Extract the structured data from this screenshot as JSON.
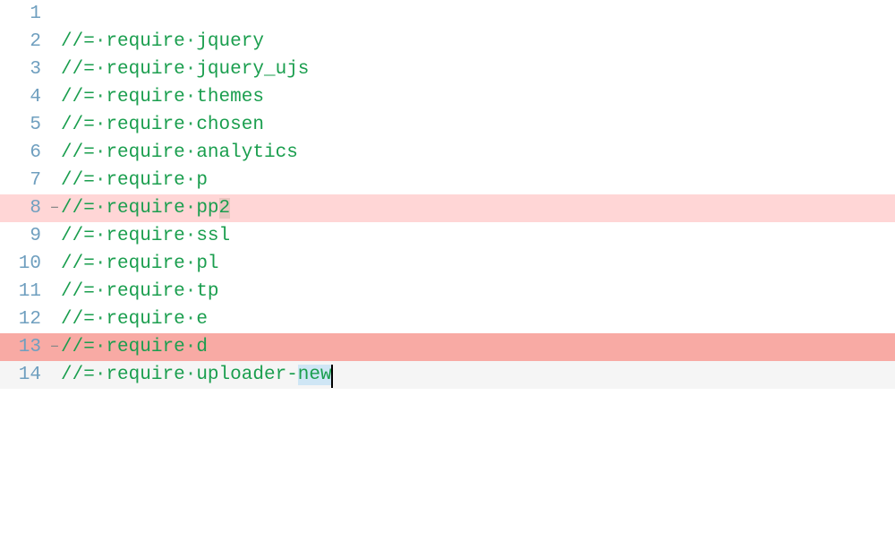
{
  "lines": [
    {
      "num": "1",
      "text": "",
      "marker": "",
      "hl": "",
      "boxStart": null,
      "boxEnd": null,
      "selStart": null,
      "selEnd": null
    },
    {
      "num": "2",
      "text": "//= require jquery",
      "marker": "",
      "hl": "",
      "boxStart": null,
      "boxEnd": null,
      "selStart": null,
      "selEnd": null
    },
    {
      "num": "3",
      "text": "//= require jquery_ujs",
      "marker": "",
      "hl": "",
      "boxStart": null,
      "boxEnd": null,
      "selStart": null,
      "selEnd": null
    },
    {
      "num": "4",
      "text": "//= require themes",
      "marker": "",
      "hl": "",
      "boxStart": null,
      "boxEnd": null,
      "selStart": null,
      "selEnd": null
    },
    {
      "num": "5",
      "text": "//= require chosen",
      "marker": "",
      "hl": "",
      "boxStart": null,
      "boxEnd": null,
      "selStart": null,
      "selEnd": null
    },
    {
      "num": "6",
      "text": "//= require analytics",
      "marker": "",
      "hl": "",
      "boxStart": null,
      "boxEnd": null,
      "selStart": null,
      "selEnd": null
    },
    {
      "num": "7",
      "text": "//= require p",
      "marker": "",
      "hl": "",
      "boxStart": null,
      "boxEnd": null,
      "selStart": null,
      "selEnd": null
    },
    {
      "num": "8",
      "text": "//= require pp2",
      "marker": "–",
      "hl": "light",
      "boxStart": 14,
      "boxEnd": 15,
      "selStart": null,
      "selEnd": null
    },
    {
      "num": "9",
      "text": "//= require ssl",
      "marker": "",
      "hl": "",
      "boxStart": null,
      "boxEnd": null,
      "selStart": null,
      "selEnd": null
    },
    {
      "num": "10",
      "text": "//= require pl",
      "marker": "",
      "hl": "",
      "boxStart": null,
      "boxEnd": null,
      "selStart": null,
      "selEnd": null
    },
    {
      "num": "11",
      "text": "//= require tp",
      "marker": "",
      "hl": "",
      "boxStart": null,
      "boxEnd": null,
      "selStart": null,
      "selEnd": null
    },
    {
      "num": "12",
      "text": "//= require e",
      "marker": "",
      "hl": "",
      "boxStart": null,
      "boxEnd": null,
      "selStart": null,
      "selEnd": null
    },
    {
      "num": "13",
      "text": "//= require d",
      "marker": "–",
      "hl": "dark",
      "boxStart": null,
      "boxEnd": null,
      "selStart": null,
      "selEnd": null
    },
    {
      "num": "14",
      "text": "//= require uploader-new",
      "marker": "",
      "hl": "current",
      "boxStart": null,
      "boxEnd": null,
      "selStart": 21,
      "selEnd": 24,
      "cursor": true
    }
  ],
  "ws_dot": "·"
}
